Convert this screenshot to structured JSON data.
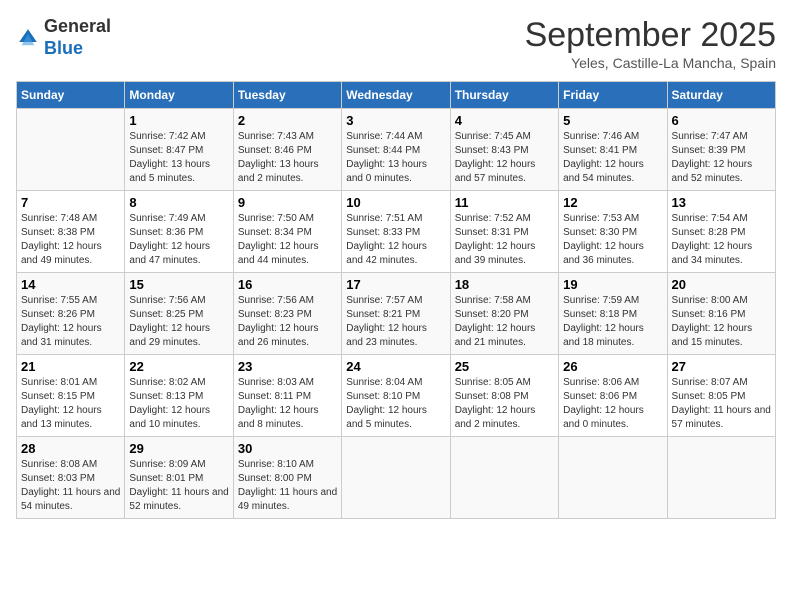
{
  "header": {
    "logo": {
      "general": "General",
      "blue": "Blue"
    },
    "title": "September 2025",
    "subtitle": "Yeles, Castille-La Mancha, Spain"
  },
  "days_of_week": [
    "Sunday",
    "Monday",
    "Tuesday",
    "Wednesday",
    "Thursday",
    "Friday",
    "Saturday"
  ],
  "weeks": [
    {
      "cells": [
        {
          "day": "",
          "sunrise": "",
          "sunset": "",
          "daylight": ""
        },
        {
          "day": "1",
          "sunrise": "Sunrise: 7:42 AM",
          "sunset": "Sunset: 8:47 PM",
          "daylight": "Daylight: 13 hours and 5 minutes."
        },
        {
          "day": "2",
          "sunrise": "Sunrise: 7:43 AM",
          "sunset": "Sunset: 8:46 PM",
          "daylight": "Daylight: 13 hours and 2 minutes."
        },
        {
          "day": "3",
          "sunrise": "Sunrise: 7:44 AM",
          "sunset": "Sunset: 8:44 PM",
          "daylight": "Daylight: 13 hours and 0 minutes."
        },
        {
          "day": "4",
          "sunrise": "Sunrise: 7:45 AM",
          "sunset": "Sunset: 8:43 PM",
          "daylight": "Daylight: 12 hours and 57 minutes."
        },
        {
          "day": "5",
          "sunrise": "Sunrise: 7:46 AM",
          "sunset": "Sunset: 8:41 PM",
          "daylight": "Daylight: 12 hours and 54 minutes."
        },
        {
          "day": "6",
          "sunrise": "Sunrise: 7:47 AM",
          "sunset": "Sunset: 8:39 PM",
          "daylight": "Daylight: 12 hours and 52 minutes."
        }
      ]
    },
    {
      "cells": [
        {
          "day": "7",
          "sunrise": "Sunrise: 7:48 AM",
          "sunset": "Sunset: 8:38 PM",
          "daylight": "Daylight: 12 hours and 49 minutes."
        },
        {
          "day": "8",
          "sunrise": "Sunrise: 7:49 AM",
          "sunset": "Sunset: 8:36 PM",
          "daylight": "Daylight: 12 hours and 47 minutes."
        },
        {
          "day": "9",
          "sunrise": "Sunrise: 7:50 AM",
          "sunset": "Sunset: 8:34 PM",
          "daylight": "Daylight: 12 hours and 44 minutes."
        },
        {
          "day": "10",
          "sunrise": "Sunrise: 7:51 AM",
          "sunset": "Sunset: 8:33 PM",
          "daylight": "Daylight: 12 hours and 42 minutes."
        },
        {
          "day": "11",
          "sunrise": "Sunrise: 7:52 AM",
          "sunset": "Sunset: 8:31 PM",
          "daylight": "Daylight: 12 hours and 39 minutes."
        },
        {
          "day": "12",
          "sunrise": "Sunrise: 7:53 AM",
          "sunset": "Sunset: 8:30 PM",
          "daylight": "Daylight: 12 hours and 36 minutes."
        },
        {
          "day": "13",
          "sunrise": "Sunrise: 7:54 AM",
          "sunset": "Sunset: 8:28 PM",
          "daylight": "Daylight: 12 hours and 34 minutes."
        }
      ]
    },
    {
      "cells": [
        {
          "day": "14",
          "sunrise": "Sunrise: 7:55 AM",
          "sunset": "Sunset: 8:26 PM",
          "daylight": "Daylight: 12 hours and 31 minutes."
        },
        {
          "day": "15",
          "sunrise": "Sunrise: 7:56 AM",
          "sunset": "Sunset: 8:25 PM",
          "daylight": "Daylight: 12 hours and 29 minutes."
        },
        {
          "day": "16",
          "sunrise": "Sunrise: 7:56 AM",
          "sunset": "Sunset: 8:23 PM",
          "daylight": "Daylight: 12 hours and 26 minutes."
        },
        {
          "day": "17",
          "sunrise": "Sunrise: 7:57 AM",
          "sunset": "Sunset: 8:21 PM",
          "daylight": "Daylight: 12 hours and 23 minutes."
        },
        {
          "day": "18",
          "sunrise": "Sunrise: 7:58 AM",
          "sunset": "Sunset: 8:20 PM",
          "daylight": "Daylight: 12 hours and 21 minutes."
        },
        {
          "day": "19",
          "sunrise": "Sunrise: 7:59 AM",
          "sunset": "Sunset: 8:18 PM",
          "daylight": "Daylight: 12 hours and 18 minutes."
        },
        {
          "day": "20",
          "sunrise": "Sunrise: 8:00 AM",
          "sunset": "Sunset: 8:16 PM",
          "daylight": "Daylight: 12 hours and 15 minutes."
        }
      ]
    },
    {
      "cells": [
        {
          "day": "21",
          "sunrise": "Sunrise: 8:01 AM",
          "sunset": "Sunset: 8:15 PM",
          "daylight": "Daylight: 12 hours and 13 minutes."
        },
        {
          "day": "22",
          "sunrise": "Sunrise: 8:02 AM",
          "sunset": "Sunset: 8:13 PM",
          "daylight": "Daylight: 12 hours and 10 minutes."
        },
        {
          "day": "23",
          "sunrise": "Sunrise: 8:03 AM",
          "sunset": "Sunset: 8:11 PM",
          "daylight": "Daylight: 12 hours and 8 minutes."
        },
        {
          "day": "24",
          "sunrise": "Sunrise: 8:04 AM",
          "sunset": "Sunset: 8:10 PM",
          "daylight": "Daylight: 12 hours and 5 minutes."
        },
        {
          "day": "25",
          "sunrise": "Sunrise: 8:05 AM",
          "sunset": "Sunset: 8:08 PM",
          "daylight": "Daylight: 12 hours and 2 minutes."
        },
        {
          "day": "26",
          "sunrise": "Sunrise: 8:06 AM",
          "sunset": "Sunset: 8:06 PM",
          "daylight": "Daylight: 12 hours and 0 minutes."
        },
        {
          "day": "27",
          "sunrise": "Sunrise: 8:07 AM",
          "sunset": "Sunset: 8:05 PM",
          "daylight": "Daylight: 11 hours and 57 minutes."
        }
      ]
    },
    {
      "cells": [
        {
          "day": "28",
          "sunrise": "Sunrise: 8:08 AM",
          "sunset": "Sunset: 8:03 PM",
          "daylight": "Daylight: 11 hours and 54 minutes."
        },
        {
          "day": "29",
          "sunrise": "Sunrise: 8:09 AM",
          "sunset": "Sunset: 8:01 PM",
          "daylight": "Daylight: 11 hours and 52 minutes."
        },
        {
          "day": "30",
          "sunrise": "Sunrise: 8:10 AM",
          "sunset": "Sunset: 8:00 PM",
          "daylight": "Daylight: 11 hours and 49 minutes."
        },
        {
          "day": "",
          "sunrise": "",
          "sunset": "",
          "daylight": ""
        },
        {
          "day": "",
          "sunrise": "",
          "sunset": "",
          "daylight": ""
        },
        {
          "day": "",
          "sunrise": "",
          "sunset": "",
          "daylight": ""
        },
        {
          "day": "",
          "sunrise": "",
          "sunset": "",
          "daylight": ""
        }
      ]
    }
  ]
}
